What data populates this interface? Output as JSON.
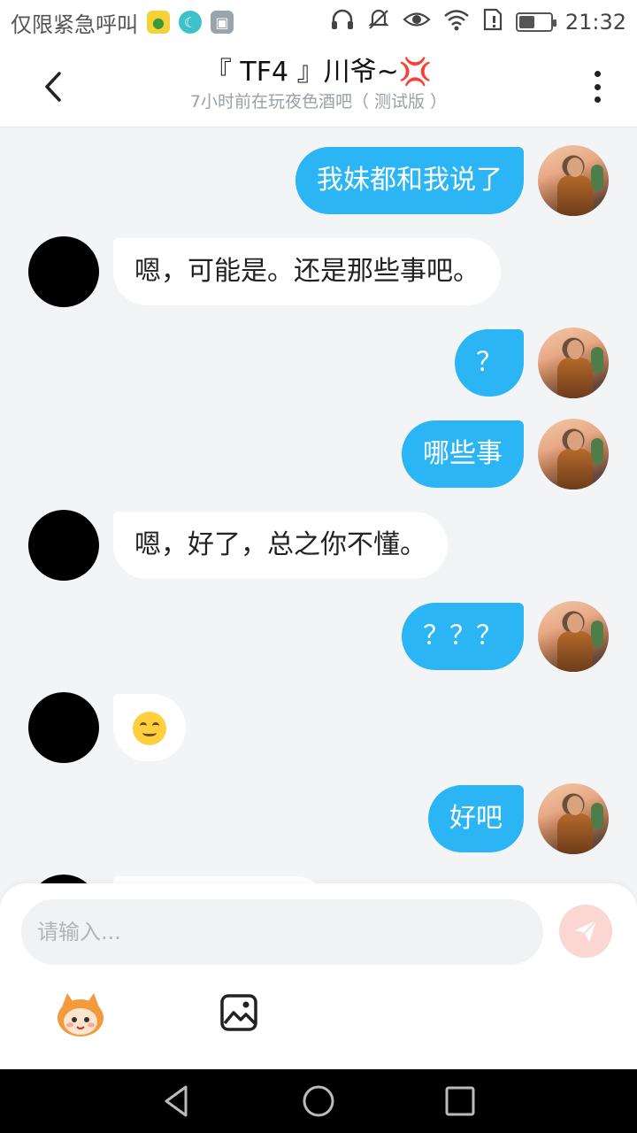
{
  "status_bar": {
    "carrier": "仅限紧急呼叫",
    "time": "21:32",
    "battery_level": 0.5,
    "icons": [
      "app-icon-yellow",
      "moon-icon",
      "image-icon",
      "headphones-icon",
      "mute-icon",
      "eye-icon",
      "wifi-icon",
      "sim-icon",
      "battery-icon"
    ]
  },
  "header": {
    "title": "『 TF4 』川爷~",
    "title_badge": "💢",
    "subtitle": "7小时前在玩夜色酒吧（ 测试版 ）",
    "back_icon": "chevron-left-icon",
    "more_icon": "more-vertical-icon"
  },
  "messages": [
    {
      "side": "me",
      "text": "我妹都和我说了"
    },
    {
      "side": "other",
      "text": "嗯，可能是。还是那些事吧。"
    },
    {
      "side": "me",
      "text": "？"
    },
    {
      "side": "me",
      "text": "哪些事"
    },
    {
      "side": "other",
      "text": "嗯，好了，总之你不懂。"
    },
    {
      "side": "me",
      "text": "？？？"
    },
    {
      "side": "other",
      "text": "",
      "emoji": "smiling-face-emoji"
    },
    {
      "side": "me",
      "text": "好吧"
    }
  ],
  "composer": {
    "placeholder": "请输入...",
    "send_icon": "send-icon",
    "tools": [
      "mascot-sticker-icon",
      "image-picker-icon"
    ]
  },
  "nav_bar": {
    "buttons": [
      "back-triangle-icon",
      "home-circle-icon",
      "recents-square-icon"
    ]
  },
  "colors": {
    "my_bubble": "#2cb5f5",
    "other_bubble": "#ffffff",
    "background": "#f3f4f6",
    "send_button": "#fbd6d2",
    "title_badge": "#ff8a00"
  }
}
